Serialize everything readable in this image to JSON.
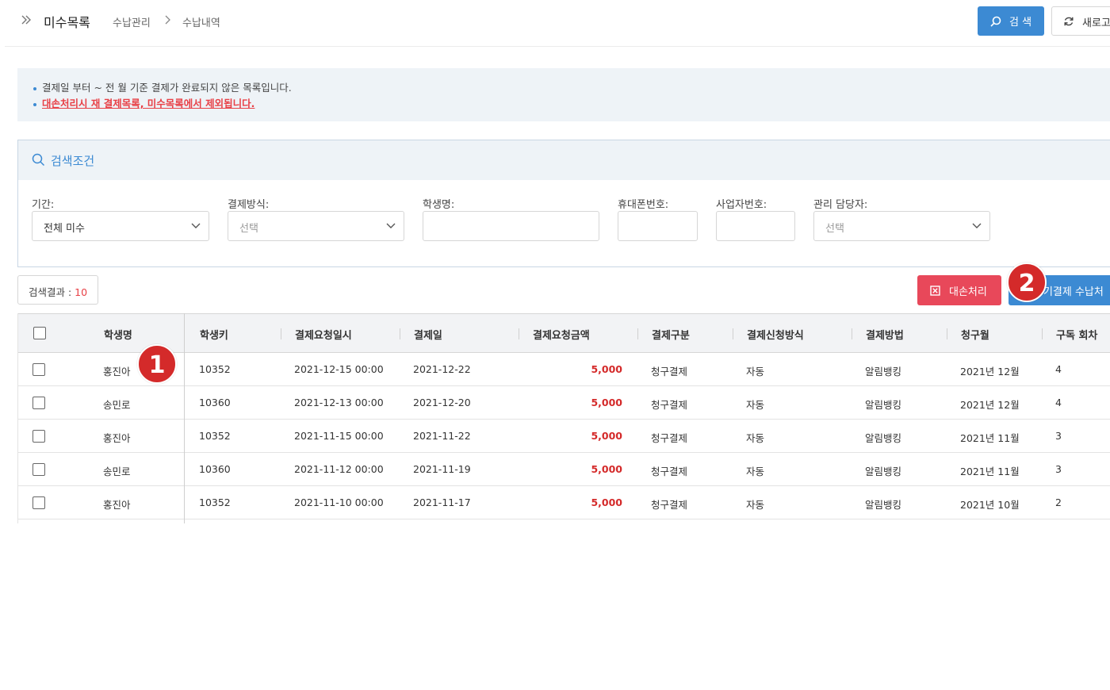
{
  "header": {
    "page_title": "미수목록",
    "breadcrumb": [
      "수납관리",
      "수납내역"
    ],
    "search_label": "검 색",
    "refresh_label": "새로고"
  },
  "notice": {
    "line1": "결제일 부터 ~ 전 월 기준 결제가 완료되지 않은 목록입니다.",
    "line2": "대손처리시 재 결제목록, 미수목록에서 제외됩니다."
  },
  "search_panel": {
    "title": "검색조건",
    "fields": {
      "period": {
        "label": "기간:",
        "value": "전체 미수"
      },
      "pay_method": {
        "label": "결제방식:",
        "placeholder": "선택"
      },
      "student_name": {
        "label": "학생명:",
        "value": ""
      },
      "phone": {
        "label": "휴대폰번호:",
        "value": ""
      },
      "biz_no": {
        "label": "사업자번호:",
        "value": ""
      },
      "manager": {
        "label": "관리 담당자:",
        "placeholder": "선택"
      }
    }
  },
  "results": {
    "label": "검색결과 : ",
    "count": "10",
    "bad_debt_label": "대손처리",
    "late_payment_label": "후기결제 수납처"
  },
  "markers": {
    "m1": "1",
    "m2": "2"
  },
  "table": {
    "columns": [
      "학생명",
      "학생키",
      "결제요청일시",
      "결제일",
      "결제요청금액",
      "결제구분",
      "결제신청방식",
      "결제방법",
      "청구월",
      "구독 회차"
    ],
    "rows": [
      {
        "name": "홍진아",
        "key": "10352",
        "req_dt": "2021-12-15 00:00",
        "pay_date": "2021-12-22",
        "amount": "5,000",
        "type": "청구결제",
        "apply": "자동",
        "method": "알림뱅킹",
        "month": "2021년 12월",
        "round": "4"
      },
      {
        "name": "송민로",
        "key": "10360",
        "req_dt": "2021-12-13 00:00",
        "pay_date": "2021-12-20",
        "amount": "5,000",
        "type": "청구결제",
        "apply": "자동",
        "method": "알림뱅킹",
        "month": "2021년 12월",
        "round": "4"
      },
      {
        "name": "홍진아",
        "key": "10352",
        "req_dt": "2021-11-15 00:00",
        "pay_date": "2021-11-22",
        "amount": "5,000",
        "type": "청구결제",
        "apply": "자동",
        "method": "알림뱅킹",
        "month": "2021년 11월",
        "round": "3"
      },
      {
        "name": "송민로",
        "key": "10360",
        "req_dt": "2021-11-12 00:00",
        "pay_date": "2021-11-19",
        "amount": "5,000",
        "type": "청구결제",
        "apply": "자동",
        "method": "알림뱅킹",
        "month": "2021년 11월",
        "round": "3"
      },
      {
        "name": "홍진아",
        "key": "10352",
        "req_dt": "2021-11-10 00:00",
        "pay_date": "2021-11-17",
        "amount": "5,000",
        "type": "청구결제",
        "apply": "자동",
        "method": "알림뱅킹",
        "month": "2021년 10월",
        "round": "2"
      }
    ]
  }
}
